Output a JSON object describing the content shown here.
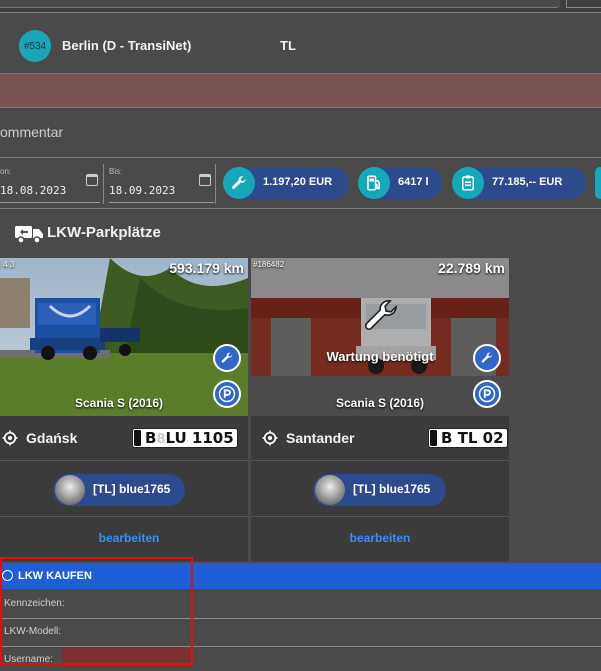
{
  "company": {
    "badge": "#534",
    "name": "Berlin (D - TransiNet)",
    "tag": "TL"
  },
  "comment_section": {
    "title": "ommentar"
  },
  "dates": {
    "from_label": "on:",
    "from_value": "18.08.2023",
    "to_label": "Bis:",
    "to_value": "18.09.2023"
  },
  "stats": [
    {
      "icon": "wrench-icon",
      "value": "1.197,20  EUR"
    },
    {
      "icon": "fuel-pump-icon",
      "value": "6417 l"
    },
    {
      "icon": "clipboard-icon",
      "value": "77.185,--  EUR"
    }
  ],
  "parking": {
    "title": "LKW-Parkplätze",
    "trucks": [
      {
        "id": "#1 4 3",
        "km": "593.179 km",
        "model": "Scania S (2016)",
        "location": "Gdańsk",
        "plate_prefix": "B",
        "plate_rest": "LU 1105",
        "user": "[TL] blue1765",
        "edit": "bearbeiten",
        "maintenance": ""
      },
      {
        "id": "#186482",
        "km": "22.789 km",
        "model": "Scania S (2016)",
        "location": "Santander",
        "plate_prefix": "B",
        "plate_rest": "TL 02",
        "user": "[TL] blue1765",
        "edit": "bearbeiten",
        "maintenance": "Wartung benötigt"
      }
    ]
  },
  "buy": {
    "title": "LKW KAUFEN",
    "fields": [
      "Kennzeichen:",
      "LKW-Modell:",
      "Username:"
    ]
  },
  "colors": {
    "accent_teal": "#16a8b8",
    "pill_blue": "#2c4a8c",
    "buy_blue": "#1f5fd6",
    "link_blue": "#3d8ff0",
    "highlight_red": "#e01010"
  }
}
